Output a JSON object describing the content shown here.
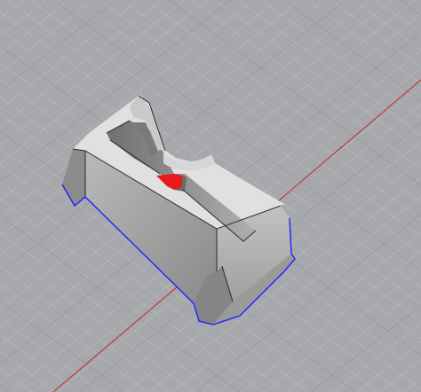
{
  "viewport": {
    "view": "perspective",
    "background_color": "#a6a8ac",
    "grid": {
      "visible": true,
      "minor_line_color": "#b4b6b9",
      "major_line_color": "#9a9c9f",
      "axis_x_color": "#c03a3a"
    }
  },
  "model": {
    "type": "solid",
    "selected": true,
    "selection_edge_color": "#2222ff",
    "highlight_face_color": "#e81a1a",
    "face_colors": {
      "top": "#e2e2e2",
      "light_side": "#cfcfcf",
      "mid_side": "#b4b4b4",
      "dark_side": "#8f8f8f",
      "darkest": "#7d7d7d"
    }
  }
}
